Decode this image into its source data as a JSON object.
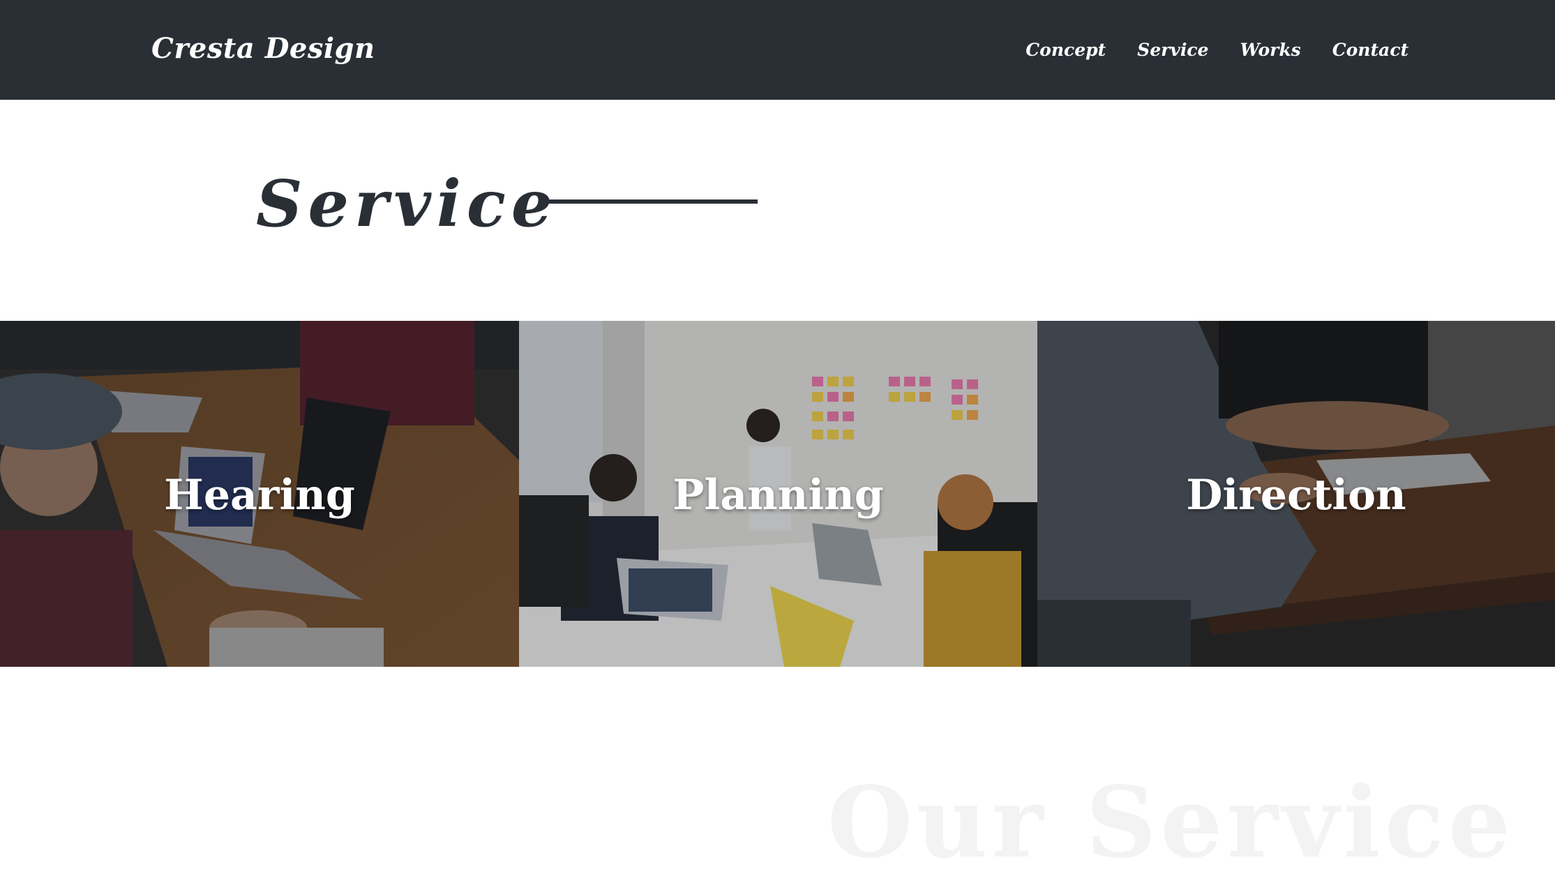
{
  "header": {
    "brand": "Cresta Design",
    "nav": [
      {
        "label": "Concept"
      },
      {
        "label": "Service"
      },
      {
        "label": "Works"
      },
      {
        "label": "Contact"
      }
    ]
  },
  "section": {
    "title": "Service"
  },
  "services": [
    {
      "label": "Hearing"
    },
    {
      "label": "Planning"
    },
    {
      "label": "Direction"
    }
  ],
  "watermark": "Our Service",
  "colors": {
    "header_bg": "#2a2f36",
    "title": "#2a2f36",
    "card_text": "#ffffff",
    "watermark": "#f3f3f3"
  }
}
